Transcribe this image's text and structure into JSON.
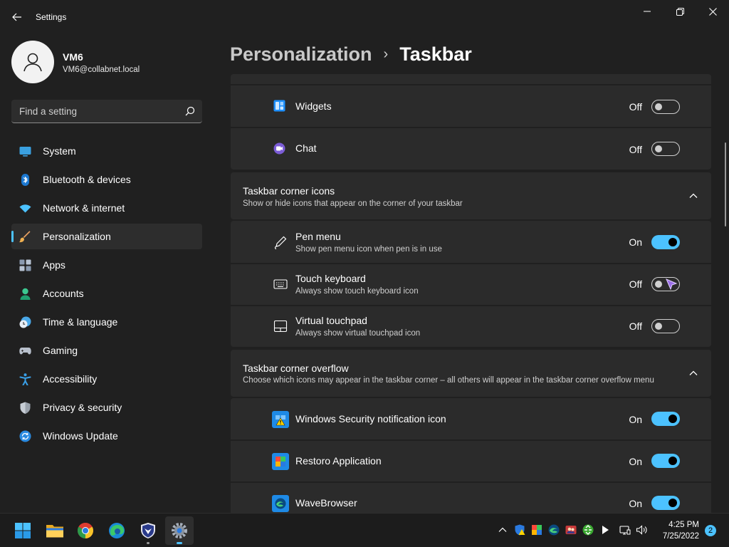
{
  "window": {
    "app_title": "Settings",
    "icons": {
      "back": "back-arrow-icon",
      "minimize": "minimize-icon",
      "maximize": "restore-icon",
      "close": "close-icon"
    }
  },
  "profile": {
    "name": "VM6",
    "email": "VM6@collabnet.local"
  },
  "search": {
    "placeholder": "Find a setting"
  },
  "sidebar": {
    "items": [
      {
        "label": "System",
        "icon": "system-monitor-icon"
      },
      {
        "label": "Bluetooth & devices",
        "icon": "bluetooth-icon"
      },
      {
        "label": "Network & internet",
        "icon": "wifi-icon"
      },
      {
        "label": "Personalization",
        "icon": "brush-icon",
        "selected": true
      },
      {
        "label": "Apps",
        "icon": "apps-icon"
      },
      {
        "label": "Accounts",
        "icon": "accounts-icon"
      },
      {
        "label": "Time & language",
        "icon": "clock-globe-icon"
      },
      {
        "label": "Gaming",
        "icon": "gamepad-icon"
      },
      {
        "label": "Accessibility",
        "icon": "accessibility-icon"
      },
      {
        "label": "Privacy & security",
        "icon": "shield-icon"
      },
      {
        "label": "Windows Update",
        "icon": "update-icon"
      }
    ]
  },
  "breadcrumb": {
    "parent": "Personalization",
    "separator": "›",
    "current": "Taskbar"
  },
  "taskbar_items": [
    {
      "label": "Widgets",
      "state": "Off",
      "on": false,
      "icon": "widgets-icon"
    },
    {
      "label": "Chat",
      "state": "Off",
      "on": false,
      "icon": "chat-icon"
    }
  ],
  "corner_icons": {
    "title": "Taskbar corner icons",
    "subtitle": "Show or hide icons that appear on the corner of your taskbar",
    "items": [
      {
        "label": "Pen menu",
        "sub": "Show pen menu icon when pen is in use",
        "state": "On",
        "on": true,
        "icon": "pen-icon"
      },
      {
        "label": "Touch keyboard",
        "sub": "Always show touch keyboard icon",
        "state": "Off",
        "on": false,
        "icon": "keyboard-icon"
      },
      {
        "label": "Virtual touchpad",
        "sub": "Always show virtual touchpad icon",
        "state": "Off",
        "on": false,
        "icon": "touchpad-icon"
      }
    ]
  },
  "corner_overflow": {
    "title": "Taskbar corner overflow",
    "subtitle": "Choose which icons may appear in the taskbar corner – all others will appear in the taskbar corner overflow menu",
    "items": [
      {
        "label": "Windows Security notification icon",
        "state": "On",
        "on": true,
        "icon": "windows-security-icon"
      },
      {
        "label": "Restoro Application",
        "state": "On",
        "on": true,
        "icon": "restoro-icon"
      },
      {
        "label": "WaveBrowser",
        "state": "On",
        "on": true,
        "icon": "wavebrowser-icon"
      }
    ]
  },
  "taskbar": {
    "apps": [
      "start-icon",
      "file-explorer-icon",
      "chrome-icon",
      "edge-icon",
      "defender-app-icon",
      "settings-gear-icon"
    ],
    "tray": [
      "chevron-up-icon",
      "security-warning-icon",
      "restoro-tray-icon",
      "wavebrowser-tray-icon",
      "people-tray-icon",
      "recycle-tray-icon",
      "play-tray-icon",
      "network-icon",
      "volume-icon"
    ],
    "time": "4:25 PM",
    "date": "7/25/2022",
    "notification_count": "2"
  },
  "colors": {
    "accent": "#4cc2ff",
    "background": "#202020",
    "card": "#2b2b2b"
  }
}
